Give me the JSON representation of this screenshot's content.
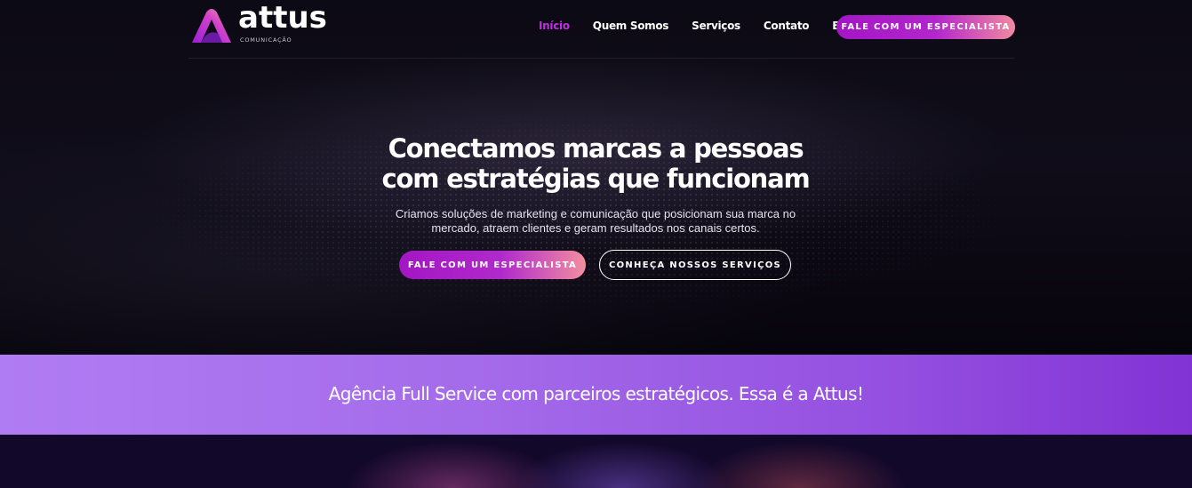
{
  "brand": {
    "name": "attus",
    "tagline": "COMUNICAÇÃO",
    "colors": {
      "accent": "#c02ee0",
      "gradient_start": "#a316c4",
      "gradient_end": "#f08aa0",
      "banner": "#a46bea"
    }
  },
  "nav": {
    "items": [
      {
        "label": "Início",
        "active": true
      },
      {
        "label": "Quem Somos",
        "active": false
      },
      {
        "label": "Serviços",
        "active": false
      },
      {
        "label": "Contato",
        "active": false
      },
      {
        "label": "Blog",
        "active": false
      }
    ],
    "cta_label": "FALE COM UM ESPECIALISTA"
  },
  "hero": {
    "title_line1": "Conectamos marcas a pessoas",
    "title_line2": "com estratégias que funcionam",
    "description_line1": "Criamos soluções de marketing e comunicação que posicionam sua marca no",
    "description_line2": "mercado, atraem clientes e geram resultados nos canais certos.",
    "primary_button": "FALE COM UM ESPECIALISTA",
    "secondary_button": "CONHEÇA NOSSOS SERVIÇOS"
  },
  "banner": {
    "text": "Agência Full Service com parceiros estratégicos. Essa é a Attus!"
  }
}
